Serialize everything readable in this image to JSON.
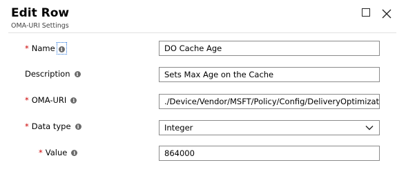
{
  "header": {
    "title": "Edit Row",
    "subtitle": "OMA-URI Settings"
  },
  "form": {
    "name": {
      "label": "Name",
      "required": "*",
      "value": "DO Cache Age"
    },
    "description": {
      "label": "Description",
      "value": "Sets Max Age on the Cache"
    },
    "oma_uri": {
      "label": "OMA-URI",
      "required": "*",
      "value": "./Device/Vendor/MSFT/Policy/Config/DeliveryOptimizatic"
    },
    "data_type": {
      "label": "Data type",
      "required": "*",
      "value": "Integer"
    },
    "value": {
      "label": "Value",
      "required": "*",
      "value": "864000"
    }
  },
  "icons": {
    "maximize": "maximize-icon",
    "close": "close-icon",
    "info": "info-icon",
    "dropdown": "chevron-down-icon"
  },
  "colors": {
    "required": "#cc0000",
    "field_border": "#8a8a8a",
    "focus_outline": "#1e6fd9"
  }
}
